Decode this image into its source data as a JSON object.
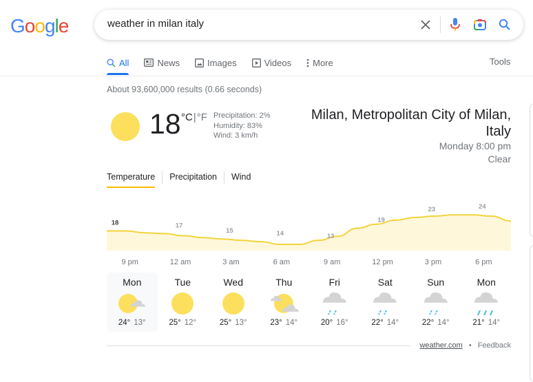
{
  "logo": {
    "letters": [
      "G",
      "o",
      "o",
      "g",
      "l",
      "e"
    ],
    "colors": [
      "#4285f4",
      "#ea4335",
      "#fbbc05",
      "#4285f4",
      "#34a853",
      "#ea4335"
    ]
  },
  "search": {
    "query": "weather in milan italy",
    "clear_icon": "close-icon",
    "voice_icon": "mic-icon",
    "lens_icon": "camera-icon",
    "search_icon": "search-icon"
  },
  "tabs": [
    {
      "label": "All",
      "icon": "search-icon",
      "active": true
    },
    {
      "label": "News",
      "icon": "news-icon"
    },
    {
      "label": "Images",
      "icon": "image-icon"
    },
    {
      "label": "Videos",
      "icon": "play-icon"
    },
    {
      "label": "More",
      "icon": "more-vert-icon"
    }
  ],
  "tools_label": "Tools",
  "result_stats": "About 93,600,000 results (0.66 seconds)",
  "weather": {
    "current_temp": "18",
    "unit_c": "°C",
    "unit_sep": "|",
    "unit_f": "°F",
    "precipitation": "Precipitation: 2%",
    "humidity": "Humidity: 83%",
    "wind": "Wind: 3 km/h",
    "location": "Milan, Metropolitan City of Milan, Italy",
    "time": "Monday 8:00 pm",
    "condition": "Clear",
    "condition_icon": "sun-icon",
    "tabs": [
      "Temperature",
      "Precipitation",
      "Wind"
    ],
    "active_tab": "Temperature",
    "days": [
      {
        "name": "Mon",
        "icon": "partly-cloudy-icon",
        "hi": "24°",
        "lo": "13°",
        "selected": true
      },
      {
        "name": "Tue",
        "icon": "sun-icon",
        "hi": "25°",
        "lo": "12°"
      },
      {
        "name": "Wed",
        "icon": "sun-icon",
        "hi": "25°",
        "lo": "13°"
      },
      {
        "name": "Thu",
        "icon": "mostly-sunny-clouds-icon",
        "hi": "23°",
        "lo": "14°"
      },
      {
        "name": "Fri",
        "icon": "rain-icon",
        "hi": "20°",
        "lo": "16°"
      },
      {
        "name": "Sat",
        "icon": "rain-icon",
        "hi": "22°",
        "lo": "14°"
      },
      {
        "name": "Sun",
        "icon": "rain-icon",
        "hi": "22°",
        "lo": "14°"
      },
      {
        "name": "Mon",
        "icon": "heavy-rain-icon",
        "hi": "21°",
        "lo": "14°"
      }
    ],
    "source": "weather.com",
    "footer_dot": "•",
    "feedback": "Feedback",
    "colors": {
      "sun": "#fcdf5c",
      "line": "#f2d43b",
      "fill": "#fef7da",
      "cloud": "#d4d4d4",
      "rain": "#4ec3d8",
      "tab_underline": "#fbbc04"
    }
  },
  "chart_data": {
    "type": "area",
    "title": "Temperature",
    "xlabel": "",
    "ylabel": "",
    "categories": [
      "9 pm",
      "12 am",
      "3 am",
      "6 am",
      "9 am",
      "12 pm",
      "3 pm",
      "6 pm"
    ],
    "values": [
      18,
      17,
      15,
      14,
      13,
      19,
      23,
      24
    ],
    "label_values": [
      "18",
      "17",
      "15",
      "14",
      "13",
      "19",
      "23",
      "24"
    ],
    "curve": [
      18,
      18,
      17.3,
      17,
      16.2,
      15.5,
      15,
      14.5,
      14,
      13,
      13,
      14.5,
      16,
      19,
      20.5,
      22,
      23,
      23.5,
      24,
      24,
      23.5,
      21.7
    ],
    "ylim": [
      11,
      26
    ],
    "grid": false,
    "legend": "none"
  }
}
